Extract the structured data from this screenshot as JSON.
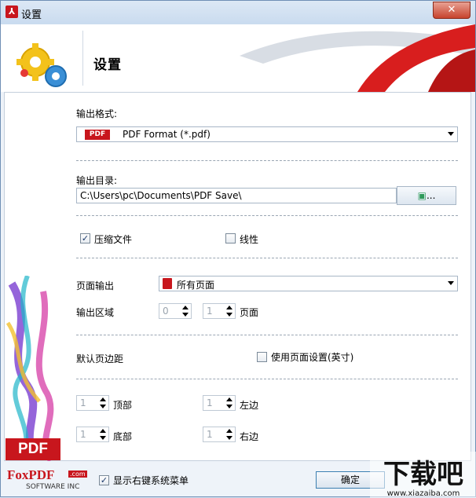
{
  "window": {
    "title": "设置",
    "close_label": "✕"
  },
  "header": {
    "title": "设置"
  },
  "output_format": {
    "label": "输出格式:",
    "tag": "PDF",
    "value": "PDF Format (*.pdf)"
  },
  "output_dir": {
    "label": "输出目录:",
    "value": "C:\\Users\\pc\\Documents\\PDF Save\\",
    "browse_label": "..."
  },
  "options": {
    "compress_label": "压缩文件",
    "compress_checked": true,
    "linear_label": "线性",
    "linear_checked": false
  },
  "page_output": {
    "label": "页面输出",
    "value": "所有页面"
  },
  "output_range": {
    "label": "输出区域",
    "from": "0",
    "to": "1",
    "unit": "页面"
  },
  "margins": {
    "label": "默认页边距",
    "use_page_label": "使用页面设置(英寸)",
    "use_page_checked": false,
    "top_label": "顶部",
    "top": "1",
    "left_label": "左边",
    "left": "1",
    "bottom_label": "底部",
    "bottom": "1",
    "right_label": "右边",
    "right": "1"
  },
  "side_badge": "PDF",
  "footer": {
    "logo_text": "FoxPDF",
    "logo_com": ".com",
    "logo_sub": "SOFTWARE INC",
    "context_menu_label": "显示右键系统菜单",
    "context_menu_checked": true,
    "ok_label": "确定"
  },
  "watermark": {
    "text": "下载吧",
    "url": "www.xiazaiba.com"
  }
}
